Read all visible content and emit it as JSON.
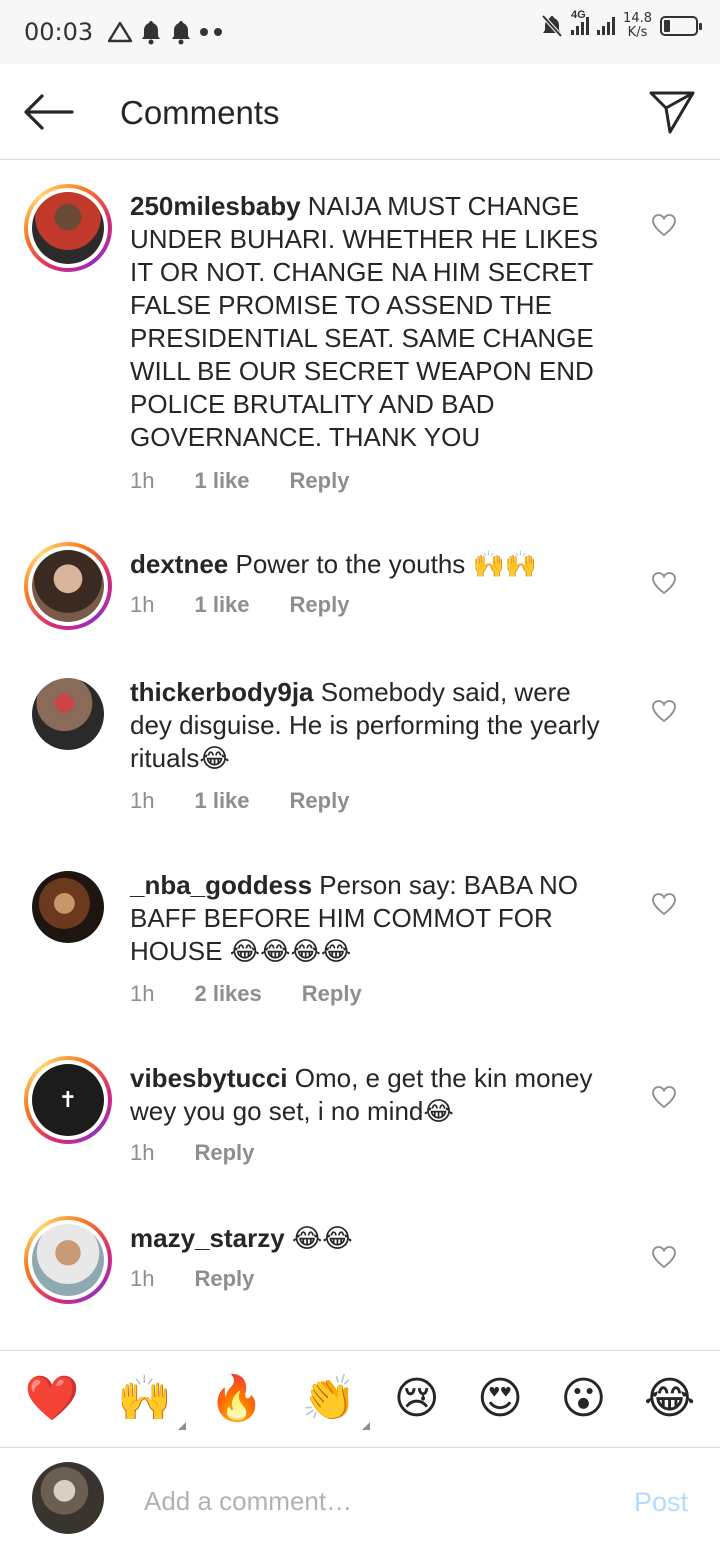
{
  "status_bar": {
    "time": "00:03",
    "network": "4G",
    "speed_value": "14.8",
    "speed_unit": "K/s",
    "battery_level": 0.2
  },
  "header": {
    "title": "Comments"
  },
  "comments": [
    {
      "username": "250milesbaby",
      "text": "NAIJA MUST CHANGE UNDER BUHARI. WHETHER HE LIKES IT OR NOT. CHANGE NA HIM SECRET FALSE PROMISE TO ASSEND THE PRESIDENTIAL SEAT. SAME CHANGE WILL BE OUR SECRET WEAPON END POLICE BRUTALITY AND BAD GOVERNANCE. THANK YOU",
      "time": "1h",
      "likes": "1 like",
      "reply": "Reply"
    },
    {
      "username": "dextnee",
      "text": "Power to the youths 🙌🙌",
      "time": "1h",
      "likes": "1 like",
      "reply": "Reply"
    },
    {
      "username": "thickerbody9ja",
      "text": "Somebody said, were dey disguise. He is performing the yearly rituals😂",
      "time": "1h",
      "likes": "1 like",
      "reply": "Reply"
    },
    {
      "username": "_nba_goddess",
      "text": "Person say: BABA NO BAFF BEFORE HIM COMMOT FOR HOUSE 😂😂😂😂",
      "time": "1h",
      "likes": "2 likes",
      "reply": "Reply"
    },
    {
      "username": "vibesbytucci",
      "text": "Omo, e get the kin money wey you go set, i no mind😂",
      "time": "1h",
      "reply": "Reply"
    },
    {
      "username": "mazy_starzy",
      "text": "😂😂",
      "time": "1h",
      "reply": "Reply"
    }
  ],
  "emoji_bar": [
    "❤️",
    "🙌",
    "🔥",
    "👏",
    "😢",
    "😍",
    "😮",
    "😂"
  ],
  "composer": {
    "placeholder": "Add a comment…",
    "post_label": "Post"
  },
  "colors": {
    "text": "#262626",
    "meta": "#8e8e8e",
    "post_disabled": "#b3dbff",
    "story_ring": "#d62976"
  }
}
